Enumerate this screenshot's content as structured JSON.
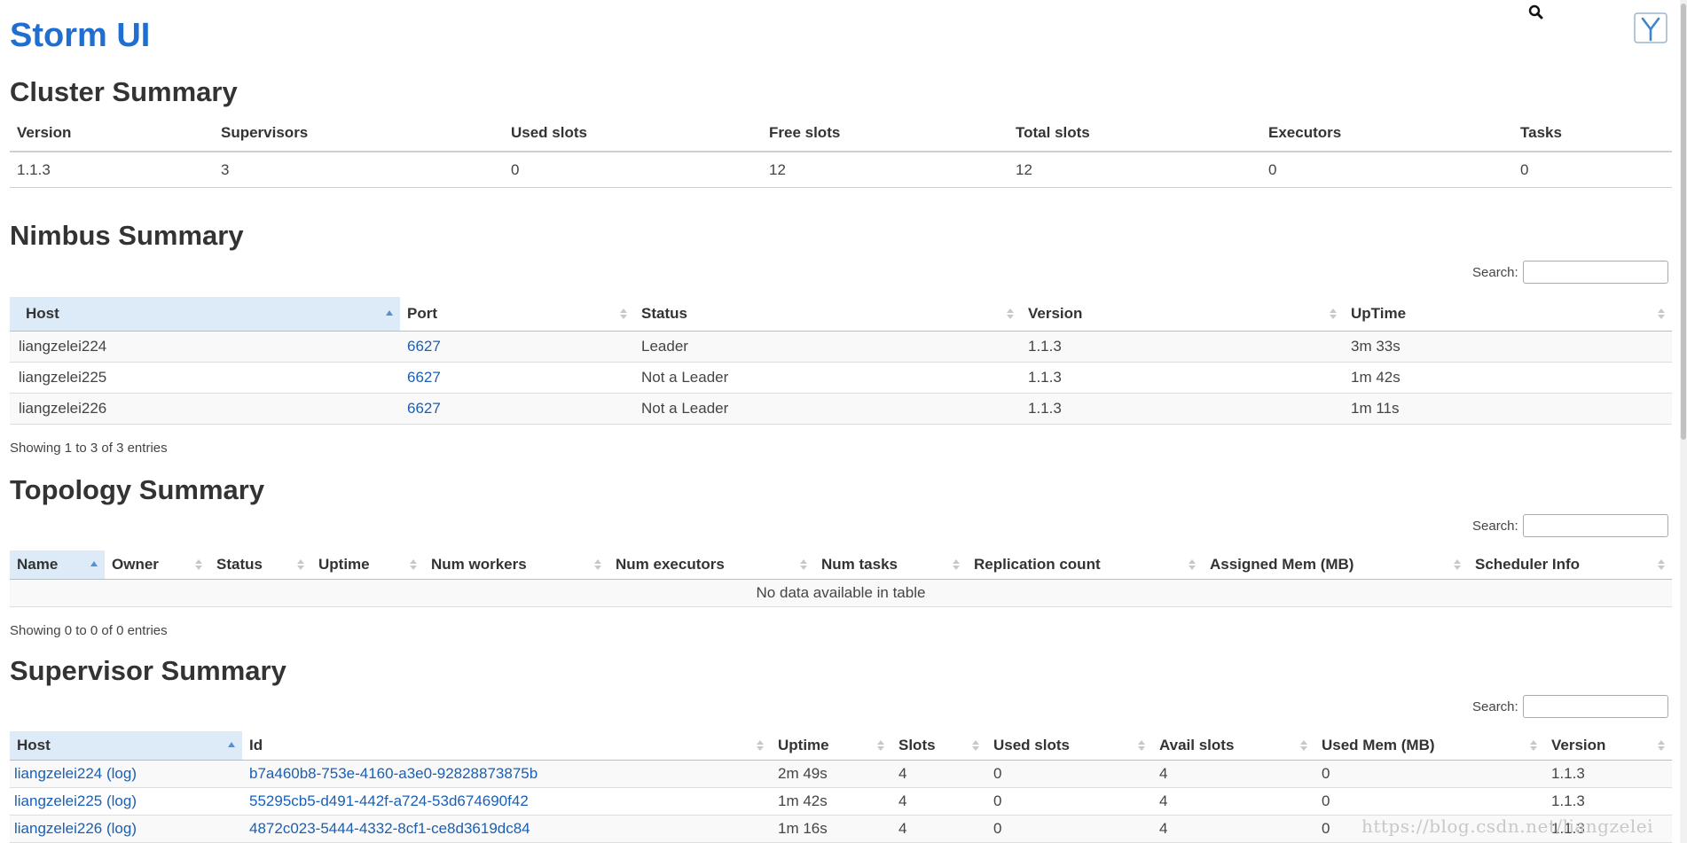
{
  "header": {
    "title": "Storm UI",
    "search_icon": "magnifier-icon",
    "logo_icon": "y-logo-icon"
  },
  "cluster": {
    "title": "Cluster Summary",
    "headers": [
      "Version",
      "Supervisors",
      "Used slots",
      "Free slots",
      "Total slots",
      "Executors",
      "Tasks"
    ],
    "values": [
      "1.1.3",
      "3",
      "0",
      "12",
      "12",
      "0",
      "0"
    ]
  },
  "nimbus": {
    "title": "Nimbus Summary",
    "search_label": "Search:",
    "headers": [
      "Host",
      "Port",
      "Status",
      "Version",
      "UpTime"
    ],
    "rows": [
      [
        "liangzelei224",
        "6627",
        "Leader",
        "1.1.3",
        "3m 33s"
      ],
      [
        "liangzelei225",
        "6627",
        "Not a Leader",
        "1.1.3",
        "1m 42s"
      ],
      [
        "liangzelei226",
        "6627",
        "Not a Leader",
        "1.1.3",
        "1m 11s"
      ]
    ],
    "info": "Showing 1 to 3 of 3 entries"
  },
  "topology": {
    "title": "Topology Summary",
    "search_label": "Search:",
    "headers": [
      "Name",
      "Owner",
      "Status",
      "Uptime",
      "Num workers",
      "Num executors",
      "Num tasks",
      "Replication count",
      "Assigned Mem (MB)",
      "Scheduler Info"
    ],
    "empty": "No data available in table",
    "info": "Showing 0 to 0 of 0 entries"
  },
  "supervisor": {
    "title": "Supervisor Summary",
    "search_label": "Search:",
    "headers": [
      "Host",
      "Id",
      "Uptime",
      "Slots",
      "Used slots",
      "Avail slots",
      "Used Mem (MB)",
      "Version"
    ],
    "rows": [
      [
        "liangzelei224",
        "(log)",
        "b7a460b8-753e-4160-a3e0-92828873875b",
        "2m 49s",
        "4",
        "0",
        "4",
        "0",
        "1.1.3"
      ],
      [
        "liangzelei225",
        "(log)",
        "55295cb5-d491-442f-a724-53d674690f42",
        "1m 42s",
        "4",
        "0",
        "4",
        "0",
        "1.1.3"
      ],
      [
        "liangzelei226",
        "(log)",
        "4872c023-5444-4332-8cf1-ce8d3619dc84",
        "1m 16s",
        "4",
        "0",
        "4",
        "0",
        "1.1.3"
      ]
    ]
  },
  "watermark": "https://blog.csdn.net/liangzelei",
  "colors": {
    "link": "#1a5fb4",
    "title": "#1f6fd0",
    "sorted_header": "#dcebf7"
  }
}
